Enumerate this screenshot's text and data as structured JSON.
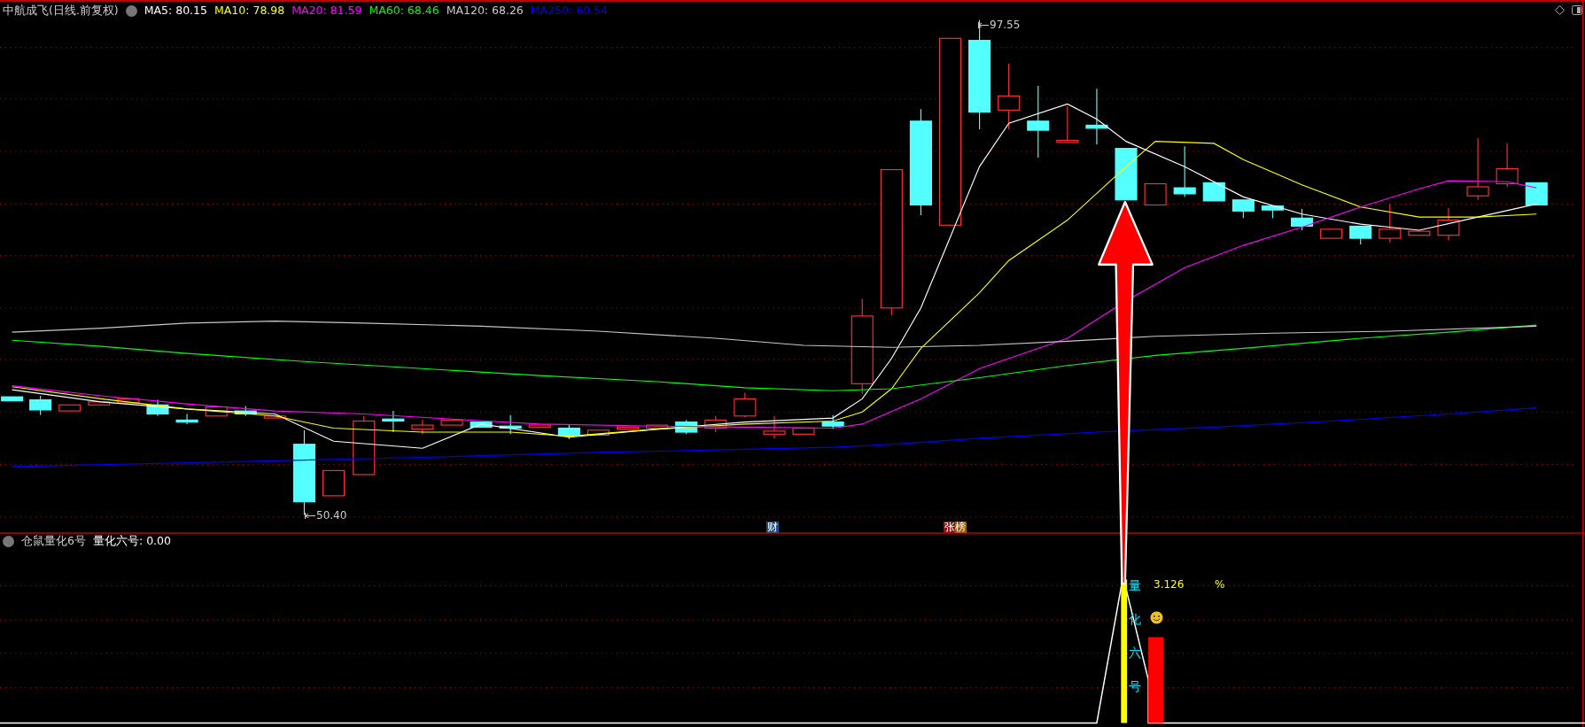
{
  "chart": {
    "title": "中航成飞(日线.前复权)",
    "moving_averages": [
      {
        "label": "MA5: 80.15",
        "color": "#ffffff"
      },
      {
        "label": "MA10: 78.98",
        "color": "#ffff00"
      },
      {
        "label": "MA20: 81.59",
        "color": "#ff00ff"
      },
      {
        "label": "MA60: 68.46",
        "color": "#00ff00"
      },
      {
        "label": "MA120: 68.26",
        "color": "#c8c8c8"
      },
      {
        "label": "MA250: 60.54",
        "color": "#0000ff"
      }
    ],
    "high_label": "97.55",
    "low_label": "50.40",
    "event_markers": [
      {
        "text": "财",
        "kind": "finance"
      },
      {
        "text": "张榜",
        "kind": "ranking"
      }
    ]
  },
  "indicator": {
    "name": "仓鼠量化6号",
    "reading": "量化六号: 0.00",
    "value": "3.126",
    "unit": "%",
    "vertical_label": "量化六号"
  }
}
